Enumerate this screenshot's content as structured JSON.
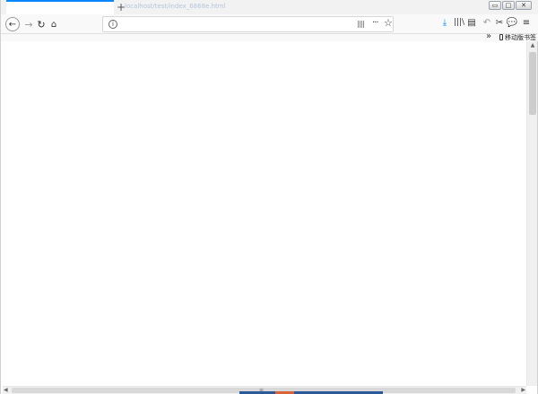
{
  "window": {
    "controls": {
      "minimize": "▭",
      "maximize": "□",
      "close": "✕"
    }
  },
  "tab": {
    "title": "",
    "new_tab_label": "+",
    "ghost_url": "localhost/test/index_6868e.html"
  },
  "nav": {
    "back": "←",
    "forward": "→",
    "reload": "↻",
    "home": "⌂"
  },
  "urlbar": {
    "value": "",
    "placeholder": "",
    "more": "···",
    "star": "☆",
    "info": "i"
  },
  "toolbar": {
    "download": "⤓",
    "library": "|||\\",
    "sidebar": "▤",
    "undo": "↶",
    "screenshot": "✂",
    "chat": "💬",
    "menu": "≡"
  },
  "bookmarks": {
    "overflow": "»",
    "mobile_label": "移动版书签"
  },
  "scrollbar": {
    "up": "▲",
    "left": "◀",
    "right": "▶",
    "grip": "≡"
  }
}
